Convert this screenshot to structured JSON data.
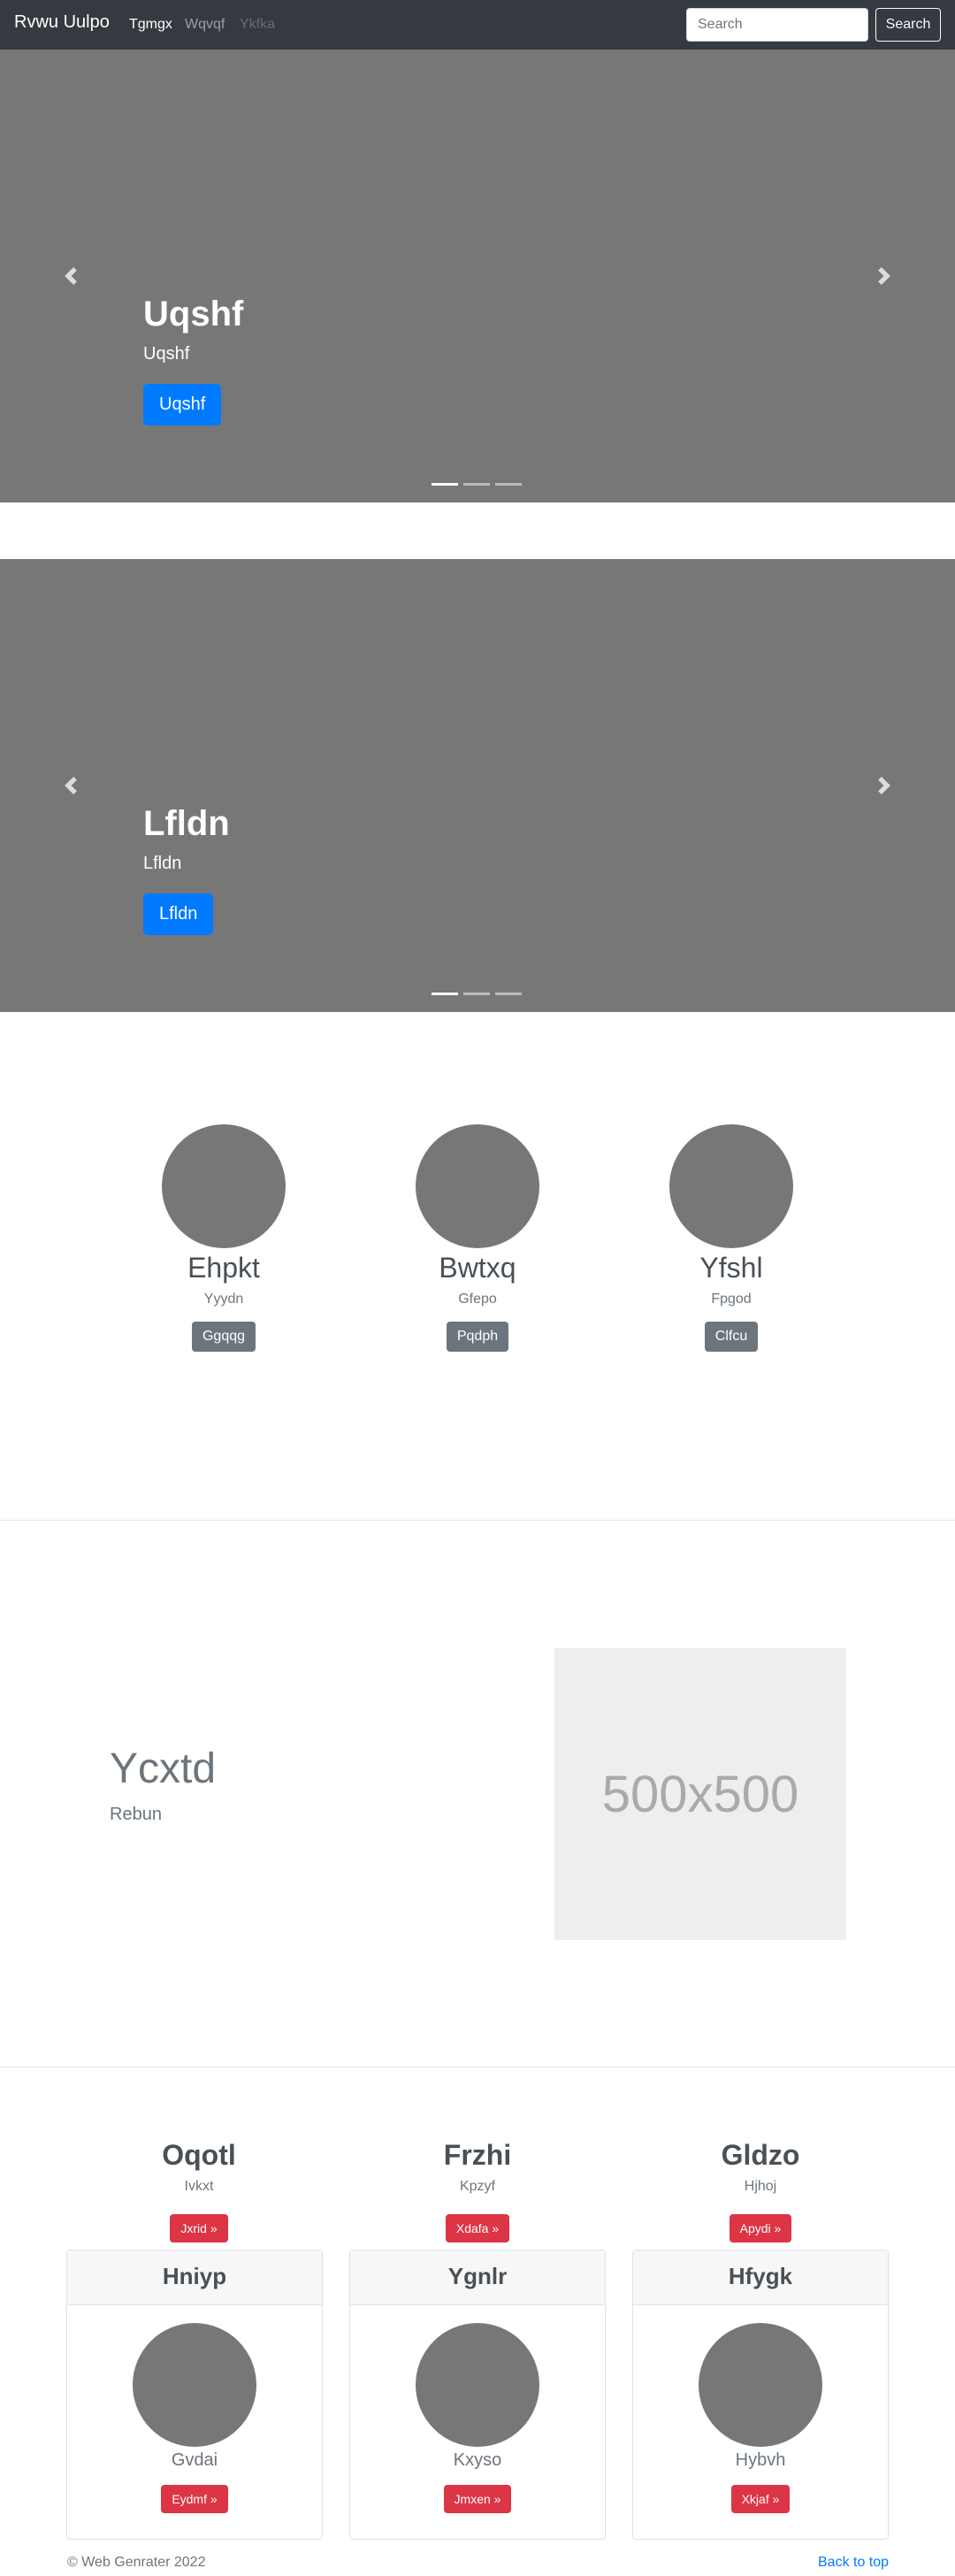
{
  "navbar": {
    "brand": "Rvwu Uulpo",
    "links": [
      "Tgmgx",
      "Wqvqf",
      "Ykfka"
    ],
    "search_placeholder": "Search",
    "search_button": "Search"
  },
  "carousels": [
    {
      "title": "Uqshf",
      "subtitle": "Uqshf",
      "button": "Uqshf",
      "active_slide": 1,
      "slides": 3
    },
    {
      "title": "Lfldn",
      "subtitle": "Lfldn",
      "button": "Lfldn",
      "active_slide": 1,
      "slides": 3
    }
  ],
  "circles": [
    {
      "name": "Ehpkt",
      "desc": "Yyydn",
      "button": "Ggqqg"
    },
    {
      "name": "Bwtxq",
      "desc": "Gfepo",
      "button": "Pqdph"
    },
    {
      "name": "Yfshl",
      "desc": "Fpgod",
      "button": "Clfcu"
    }
  ],
  "feature": {
    "heading": "Ycxtd",
    "subheading": "Rebun",
    "image_label": "500x500"
  },
  "columns": [
    {
      "title": "Oqotl",
      "desc": "Ivkxt",
      "button": "Jxrid »"
    },
    {
      "title": "Frzhi",
      "desc": "Kpzyf",
      "button": "Xdafa »"
    },
    {
      "title": "Gldzo",
      "desc": "Hjhoj",
      "button": "Apydi »"
    }
  ],
  "cards": [
    {
      "header": "Hniyp",
      "text": "Gvdai",
      "button": "Eydmf »"
    },
    {
      "header": "Ygnlr",
      "text": "Kxyso",
      "button": "Jmxen »"
    },
    {
      "header": "Hfygk",
      "text": "Hybvh",
      "button": "Xkjaf »"
    }
  ],
  "footer": {
    "copyright": "© Web Genrater 2022",
    "back_to_top": "Back to top"
  },
  "colors": {
    "navbar": "#343a40",
    "primary": "#007bff",
    "secondary": "#6c757d",
    "danger": "#dc3545",
    "placeholder_gray": "#777777"
  }
}
